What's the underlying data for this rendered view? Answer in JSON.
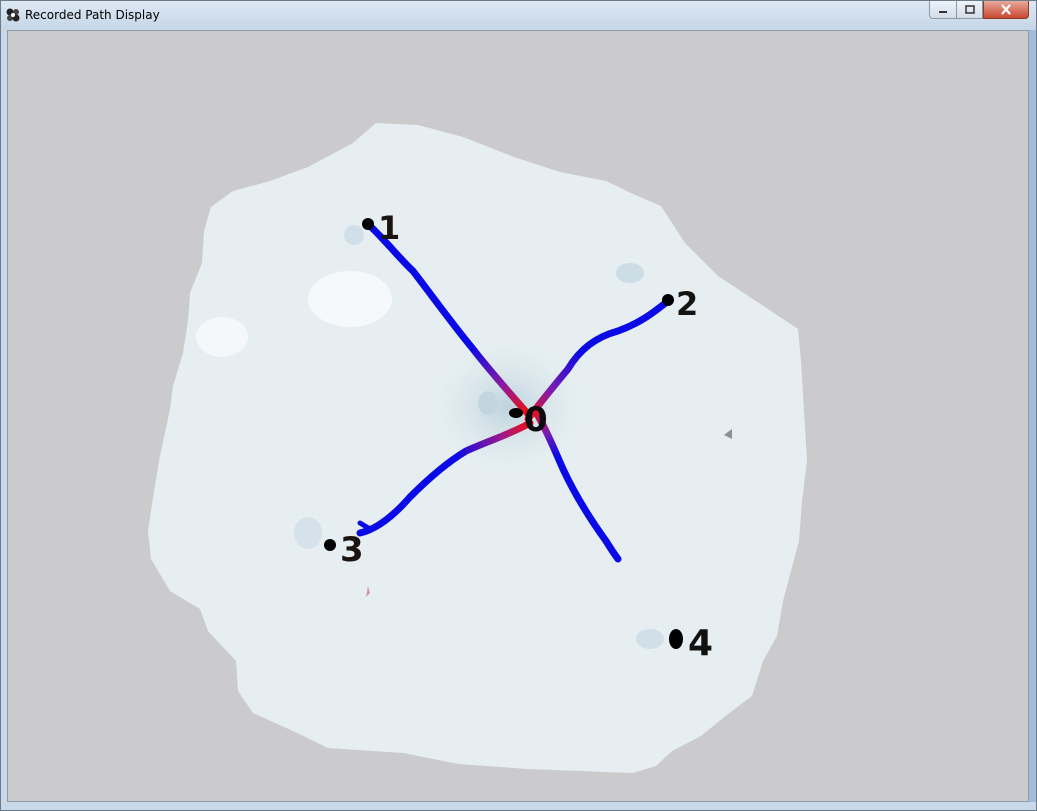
{
  "window": {
    "title": "Recorded Path Display",
    "caption_buttons": [
      "minimize",
      "maximize",
      "close"
    ]
  },
  "display": {
    "markers": [
      {
        "label": "0"
      },
      {
        "label": "1"
      },
      {
        "label": "2"
      },
      {
        "label": "3"
      },
      {
        "label": "4"
      }
    ],
    "path_colors": {
      "far": "#0a0ae6",
      "near": "#ee1111",
      "marker": "#000000",
      "map": "#e6eef1",
      "background": "#cbcbcd"
    },
    "icons": [
      "app-icon",
      "minimize-icon",
      "maximize-icon",
      "close-icon"
    ]
  }
}
